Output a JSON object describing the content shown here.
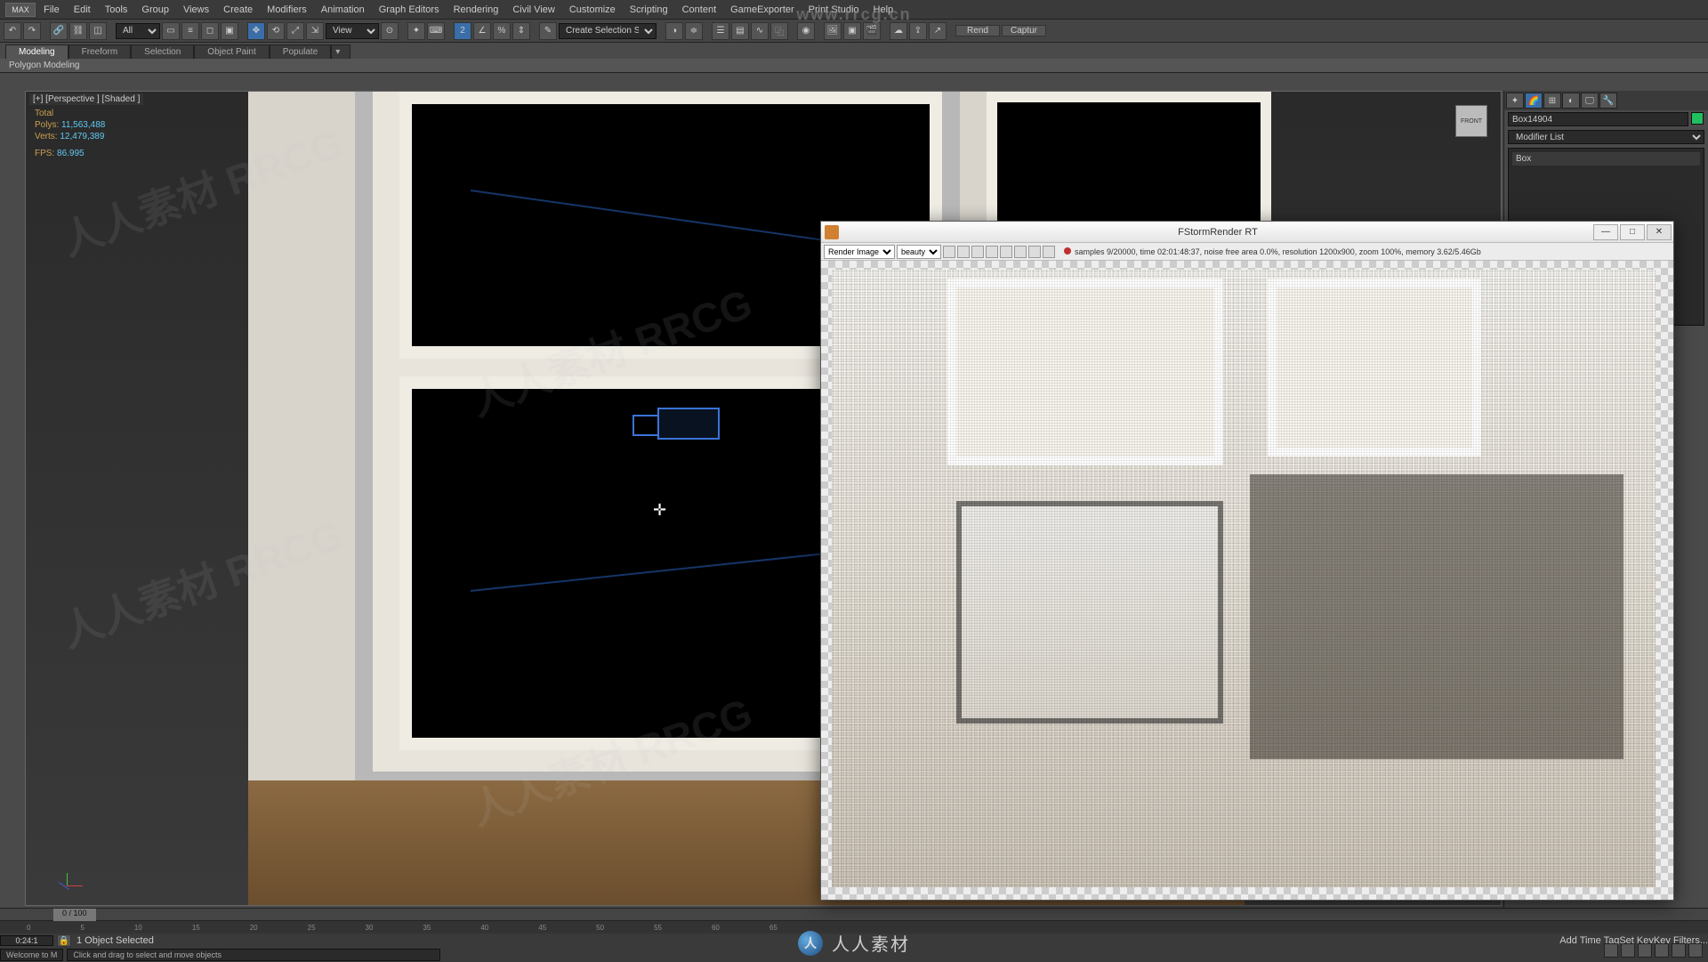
{
  "watermark_url": "www.rrcg.cn",
  "footer_logo_letter": "人",
  "footer_text": "人人素材",
  "diag_watermark": "人人素材 RRCG",
  "menubar": {
    "logo": "MAX",
    "items": [
      "File",
      "Edit",
      "Tools",
      "Group",
      "Views",
      "Create",
      "Modifiers",
      "Animation",
      "Graph Editors",
      "Rendering",
      "Civil View",
      "Customize",
      "Scripting",
      "Content",
      "GameExporter",
      "Print Studio",
      "Help"
    ]
  },
  "toolbar1": {
    "dropdown_all": "All",
    "dropdown_view": "View",
    "create_sel": "Create Selection Se",
    "render_btn": "Rend",
    "caption_btn": "Captur"
  },
  "ribbon": {
    "tabs": [
      "Modeling",
      "Freeform",
      "Selection",
      "Object Paint",
      "Populate"
    ],
    "sub": "Polygon Modeling"
  },
  "viewport": {
    "label": "[+] [Perspective ] [Shaded ]",
    "stats": {
      "total_label": "Total",
      "polys_label": "Polys:",
      "polys_value": "11,563,488",
      "verts_label": "Verts:",
      "verts_value": "12,479,389",
      "fps_label": "FPS:",
      "fps_value": "86.995"
    },
    "viewcube": "FRONT"
  },
  "command_panel": {
    "object_name": "Box14904",
    "modifier_list_label": "Modifier List",
    "stack_top": "Box"
  },
  "render_window": {
    "title": "FStormRender RT",
    "image_dropdown": "Render Image",
    "pass_dropdown": "beauty",
    "status": "samples 9/20000,  time 02:01:48:37,  noise free area 0.0%,  resolution 1200x900,  zoom 100%,  memory 3.62/5.46Gb"
  },
  "timeline": {
    "slider_label": "0 / 100",
    "ticks": [
      "0",
      "5",
      "10",
      "15",
      "20",
      "25",
      "30",
      "35",
      "40",
      "45",
      "50",
      "55",
      "60",
      "65"
    ],
    "timecode": "0:24:1"
  },
  "status_bar": {
    "selection": "1 Object Selected",
    "welcome": "Welcome to M",
    "prompt": "Click and drag to select and move objects",
    "set_key": "Set Key",
    "key_filters": "Key Filters...",
    "add_time_tag": "Add Time Tag"
  }
}
